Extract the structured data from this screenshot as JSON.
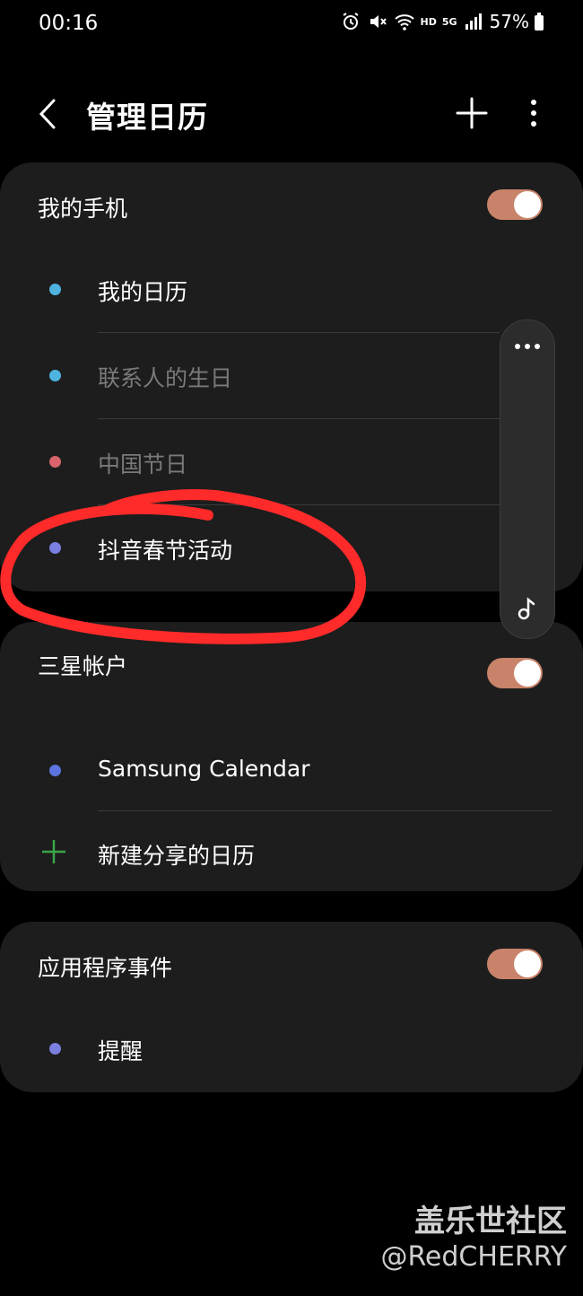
{
  "status_bar": {
    "time": "00:16",
    "network": "HD",
    "signal_label": "5G",
    "battery": "57%"
  },
  "header": {
    "title": "管理日历"
  },
  "sections": {
    "my_phone": {
      "title": "我的手机",
      "toggle_on": true,
      "items": [
        {
          "label": "我的日历",
          "color": "#4fb3e0",
          "dimmed": false
        },
        {
          "label": "联系人的生日",
          "color": "#4fb3e0",
          "dimmed": true
        },
        {
          "label": "中国节日",
          "color": "#d9646b",
          "dimmed": true
        },
        {
          "label": "抖音春节活动",
          "color": "#7a7fe0",
          "dimmed": false
        }
      ]
    },
    "samsung_account": {
      "title": "三星帐户",
      "toggle_on": true,
      "items": [
        {
          "label": "Samsung Calendar",
          "color": "#5b74e0",
          "dimmed": false
        }
      ],
      "new_shared_label": "新建分享的日历"
    },
    "app_events": {
      "title": "应用程序事件",
      "toggle_on": true,
      "items": [
        {
          "label": "提醒",
          "color": "#7a7fe0",
          "dimmed": false
        }
      ]
    }
  },
  "colors": {
    "toggle": "#c8836a",
    "card": "#1d1d1d",
    "annotation": "#ff2a2a",
    "plus": "#3aa64a"
  },
  "watermark": {
    "title": "盖乐世社区",
    "handle": "@RedCHERRY"
  }
}
